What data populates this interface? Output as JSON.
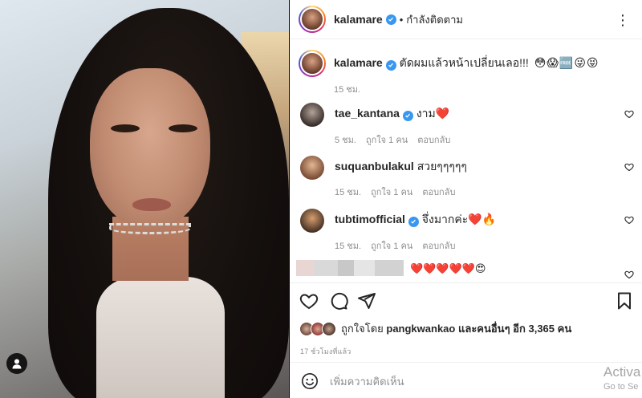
{
  "post": {
    "username": "kalamare",
    "follow_status": "กำลังติดตาม",
    "more_icon": "more-horizontal-icon",
    "caption": {
      "username": "kalamare",
      "text": "ตัดผมแล้วหน้าเปลี่ยนเลอ!!!",
      "emojis": "😳😱🆓😜😝",
      "time": "15 ชม."
    },
    "comments": [
      {
        "username": "tae_kantana",
        "verified": true,
        "text": "งาม",
        "emoji": "❤️",
        "time": "5 ชม.",
        "likes": "ถูกใจ 1 คน",
        "reply": "ตอบกลับ"
      },
      {
        "username": "suquanbulakul",
        "verified": false,
        "text": "สวยๆๆๆๆๆ",
        "emoji": "",
        "time": "15 ชม.",
        "likes": "ถูกใจ 1 คน",
        "reply": "ตอบกลับ"
      },
      {
        "username": "tubtimofficial",
        "verified": true,
        "text": "จึ่งมากค่ะ",
        "emoji": "❤️🔥",
        "time": "15 ชม.",
        "likes": "ถูกใจ 1 คน",
        "reply": "ตอบกลับ"
      },
      {
        "username": "",
        "verified": false,
        "text": "",
        "emoji": "❤️❤️❤️❤️❤️😍",
        "time": "",
        "likes": "",
        "reply": ""
      }
    ],
    "liked_by": {
      "prefix": "ถูกใจโดย",
      "user": "pangkwankao",
      "middle": "และคนอื่นๆ อีก",
      "count": "3,365",
      "suffix": "คน"
    },
    "timestamp": "17 ชั่วโมงที่แล้ว",
    "add_comment_placeholder": "เพิ่มความคิดเห็น",
    "watermark_line1": "Activa",
    "watermark_line2": "Go to Se"
  },
  "colors": {
    "verified": "#3897f0",
    "heart": "#ed4956",
    "muted": "#8e8e8e",
    "text": "#262626"
  }
}
